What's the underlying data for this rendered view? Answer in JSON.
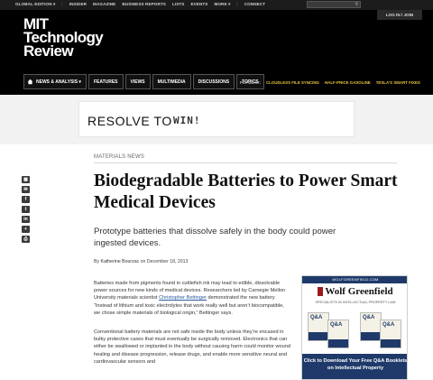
{
  "topbar": {
    "nav": [
      "GLOBAL EDITION ▾",
      "INSIDER",
      "MAGAZINE",
      "BUSINESS REPORTS",
      "LISTS",
      "EVENTS",
      "MORE ▾",
      "CONNECT"
    ],
    "login": "LOG IN / JOIN"
  },
  "logo": {
    "line1": "MIT",
    "line2": "Technology",
    "line3": "Review"
  },
  "mainnav": {
    "items": [
      "NEWS & ANALYSIS ▾",
      "FEATURES",
      "VIEWS",
      "MULTIMEDIA",
      "DISCUSSIONS",
      "TOPICS"
    ],
    "popular_label": "POPULAR:",
    "popular": [
      "CLOUDLESS FILE SYNCING",
      "HALF-PRICE GASOLINE",
      "TESLA'S SMART FIXES"
    ]
  },
  "ad_banner": {
    "text": "RESOLVE TO",
    "win": "WIN!"
  },
  "article": {
    "section": "MATERIALS NEWS",
    "title": "Biodegradable Batteries to Power Smart Medical Devices",
    "deck": "Prototype batteries that dissolve safely in the body could power ingested devices.",
    "byline_prefix": "By",
    "author": "Katherine Bourzac",
    "byline_suffix": "on December 18, 2013",
    "p1_before": "Batteries made from pigments found in cuttlefish ink may lead to edible, dissolvable power sources for new kinds of medical devices. Researchers led by Carnegie Mellon University materials scientist",
    "p1_link": "Christopher Bettinger",
    "p1_after": "demonstrated the new battery. “Instead of lithium and toxic electrolytes that work really well but aren’t biocompatible, we chose simple materials of biological origin,” Bettinger says.",
    "p2": "Conventional battery materials are not safe inside the body unless they’re encased in bulky protective cases that must eventually be surgically removed. Electronics that can either be swallowed or implanted in the body without causing harm could monitor wound healing and disease progression, release drugs, and enable more sensitive neural and cardiovascular sensors and"
  },
  "share_icons": [
    "comment-icon",
    "email-icon",
    "facebook-icon",
    "twitter-icon",
    "linkedin-icon",
    "plus-icon",
    "print-icon"
  ],
  "sidebar_ad": {
    "topline": "WOLFGREENFIELD.COM",
    "brand": "Wolf Greenfield",
    "tagline": "SPECIALISTS IN INTELLECTUAL PROPERTY LAW",
    "book_label": "Q&A",
    "cta": "Click to Download Your Free Q&A Booklets on Intellectual Property"
  },
  "colors": {
    "header_bg": "#000000",
    "popular_link": "#e8c342",
    "link": "#2b5a9c",
    "ad_navy": "#1f3a6a",
    "ad_red": "#9b1b1b"
  }
}
